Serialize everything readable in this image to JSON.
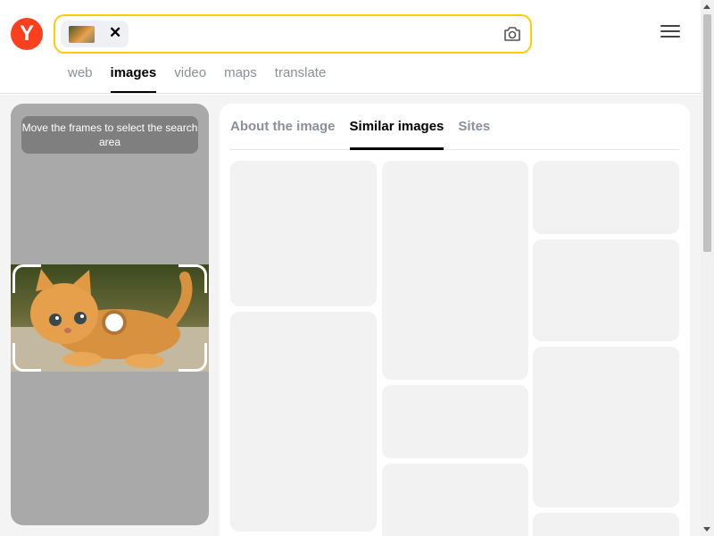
{
  "header": {
    "logo_letter": "Y",
    "search": {
      "chip_close": "✕"
    },
    "nav": [
      {
        "label": "web",
        "active": false
      },
      {
        "label": "images",
        "active": true
      },
      {
        "label": "video",
        "active": false
      },
      {
        "label": "maps",
        "active": false
      },
      {
        "label": "translate",
        "active": false
      }
    ]
  },
  "crop_panel": {
    "hint": "Move the frames to select the search area"
  },
  "results": {
    "tabs": [
      {
        "label": "About the image",
        "active": false
      },
      {
        "label": "Similar images",
        "active": true
      },
      {
        "label": "Sites",
        "active": false
      }
    ]
  },
  "colors": {
    "brand": "#fc3f1d",
    "search_border": "#ffcc00",
    "placeholder_tile": "#f2f2f3"
  }
}
